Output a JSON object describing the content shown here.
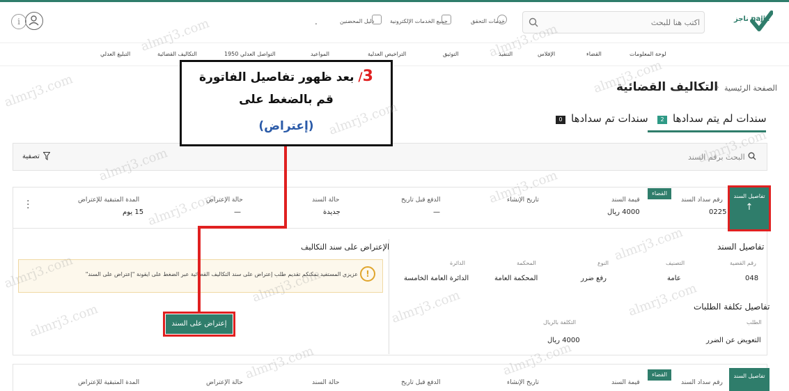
{
  "header": {
    "logo_text": "ناجز najiz",
    "search_placeholder": "اكتب هنا للبحث",
    "links": [
      {
        "label": "خدمات التحقق",
        "icon": "shield-check-icon"
      },
      {
        "label": "جميع الخدمات الإلكترونية",
        "icon": "grid-icon"
      },
      {
        "label": "دليل المحضنين",
        "icon": "book-icon"
      }
    ],
    "dot": "."
  },
  "nav": {
    "items": [
      "لوحة المعلومات",
      "القضاء",
      "الإفلاس",
      "التنفيذ",
      "التوثيق",
      "التراخيص العدلية",
      "المواعيد",
      "التواصل العدلي 1950",
      "التكاليف القضائية",
      "التبليغ العدلي"
    ]
  },
  "breadcrumb": {
    "home": "الصفحة الرئيسية",
    "separator": "›",
    "title": "التكاليف القضائية"
  },
  "tabs": [
    {
      "label": "سندات لم يتم سدادها",
      "badge": "2",
      "active": true
    },
    {
      "label": "سندات تم سدادها",
      "badge": "0",
      "active": false
    }
  ],
  "filter": {
    "search_placeholder": "البحث برقم السند",
    "filter_label": "تصفية"
  },
  "bill": {
    "details_button": "تفاصيل السند",
    "court_badge": "القضاء",
    "fields": {
      "bill_number_label": "رقم سداد السند",
      "bill_number_value": "0225",
      "amount_label": "قيمة السند",
      "amount_value": "4000 ريال",
      "created_label": "تاريخ الإنشاء",
      "created_value": "",
      "pay_before_label": "الدفع قبل تاريخ",
      "pay_before_value": "—",
      "status_label": "حالة السند",
      "status_value": "جديدة",
      "objection_status_label": "حالة الإعتراض",
      "objection_status_value": "—",
      "remaining_label": "المدة المتبقية للإعتراض",
      "remaining_value": "15 يوم"
    },
    "details": {
      "title": "تفاصيل السند",
      "case_number_label": "رقم القضية",
      "case_number_value": "048",
      "category_label": "التصنيف",
      "category_value": "عامة",
      "type_label": "النوع",
      "type_value": "رفع ضرر",
      "court_label": "المحكمة",
      "court_value": "المحكمة العامة",
      "circuit_label": "الدائرة",
      "circuit_value": "الدائرة العامة الخامسة"
    },
    "cost": {
      "title": "تفاصيل تكلفة الطلبات",
      "request_label": "الطلب",
      "request_value": "التعويض عن الضرر",
      "cost_label": "التكلفة بالريال",
      "cost_value": "4000 ريال"
    },
    "objection": {
      "title": "الإعتراض على سند التكاليف",
      "notice_icon": "!",
      "notice": "عزيزي المستفيد بمكنكم تقديم طلب إعتراض على سند التكاليف القضائية عبر الضغط على ايقونة \"إعتراض على السند\"",
      "button": "إعتراض على السند"
    }
  },
  "bill2": {
    "details_button": "تفاصيل السند",
    "court_badge": "القضاء",
    "labels": [
      "رقم سداد السند",
      "قيمة السند",
      "تاريخ الإنشاء",
      "الدفع قبل تاريخ",
      "حالة السند",
      "حالة الإعتراض",
      "المدة المتبقية للإعتراض"
    ]
  },
  "annotation": {
    "step_number": "3",
    "line1": "بعد ظهور تفاصيل الفاتورة",
    "line2": "قم بالضغط على",
    "line3": "(إعتراض)"
  },
  "watermark": "almrj3.com",
  "colors": {
    "brand": "#2f7d6b",
    "highlight": "#e02020",
    "annotation_blue": "#2a5aa8",
    "notice_bg": "#fdf8ec"
  }
}
